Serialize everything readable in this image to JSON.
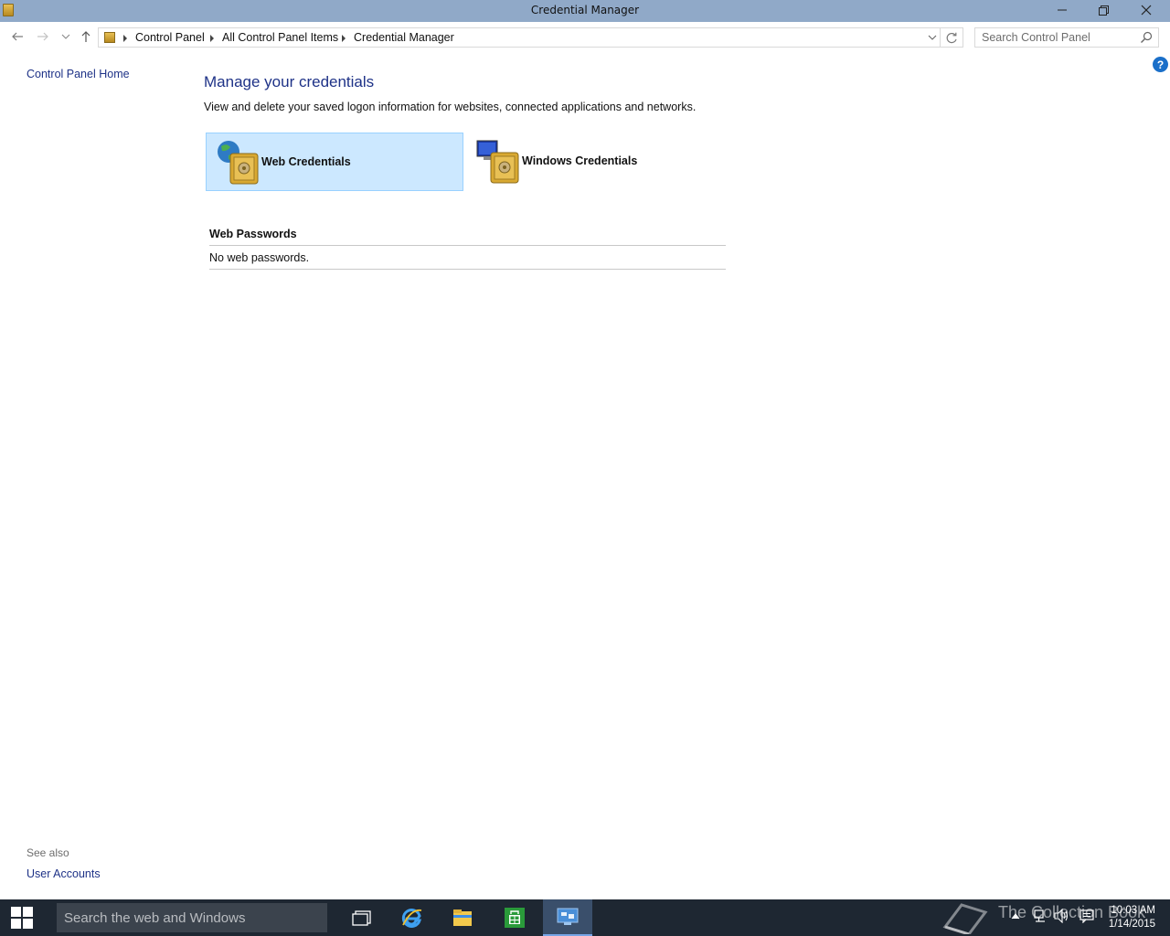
{
  "window": {
    "title": "Credential Manager",
    "minimize_icon": "minimize-icon",
    "restore_icon": "restore-icon",
    "close_icon": "close-icon"
  },
  "nav": {
    "breadcrumbs": [
      "Control Panel",
      "All Control Panel Items",
      "Credential Manager"
    ],
    "search_placeholder": "Search Control Panel"
  },
  "sidebar": {
    "home_link": "Control Panel Home",
    "see_also": "See also",
    "user_accounts_link": "User Accounts"
  },
  "main": {
    "heading": "Manage your credentials",
    "description": "View and delete your saved logon information for websites, connected applications and networks.",
    "credential_types": [
      {
        "label": "Web Credentials",
        "selected": true
      },
      {
        "label": "Windows Credentials",
        "selected": false
      }
    ],
    "section_title": "Web Passwords",
    "empty_message": "No web passwords."
  },
  "help_label": "?",
  "taskbar": {
    "search_placeholder": "Search the web and Windows",
    "watermark": "The Collection Book",
    "time": "10:03 AM",
    "date": "1/14/2015"
  }
}
